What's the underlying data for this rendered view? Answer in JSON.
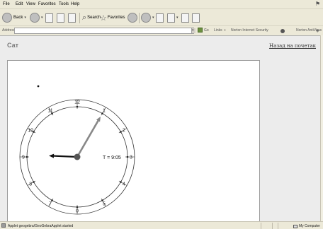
{
  "menu": [
    "File",
    "Edit",
    "View",
    "Favorites",
    "Tools",
    "Help"
  ],
  "toolbar": {
    "back": "Back",
    "search": "Search",
    "favorites": "Favorites",
    "icons": [
      "back-arrow-icon",
      "forward-arrow-icon",
      "stop-icon",
      "refresh-icon",
      "home-icon",
      "search-icon",
      "favorites-star-icon",
      "history-icon",
      "mail-icon",
      "print-icon",
      "edit-icon",
      "discuss-icon",
      "messenger-icon"
    ]
  },
  "addressbar": {
    "label": "Address",
    "value": "",
    "go": "Go",
    "links": "Links",
    "norton_security": "Norton Internet Security",
    "norton_antivirus": "Norton AntiVirus"
  },
  "page": {
    "title": "Сат",
    "back_link": "Назад на почетак"
  },
  "clock": {
    "hour_numbers": [
      "12",
      "1",
      "2",
      "3",
      "4",
      "5",
      "0",
      "7",
      "8",
      "9",
      "10",
      "11"
    ],
    "time_label": "T = 9:05",
    "hour_hand_value": 9.08,
    "minute_hand_value": 5,
    "minute_hand_color": "#888888",
    "hour_hand_color": "#111111"
  },
  "status": {
    "text": "Applet geogebra/GeoGebraApplet started",
    "zone": "My Computer"
  }
}
